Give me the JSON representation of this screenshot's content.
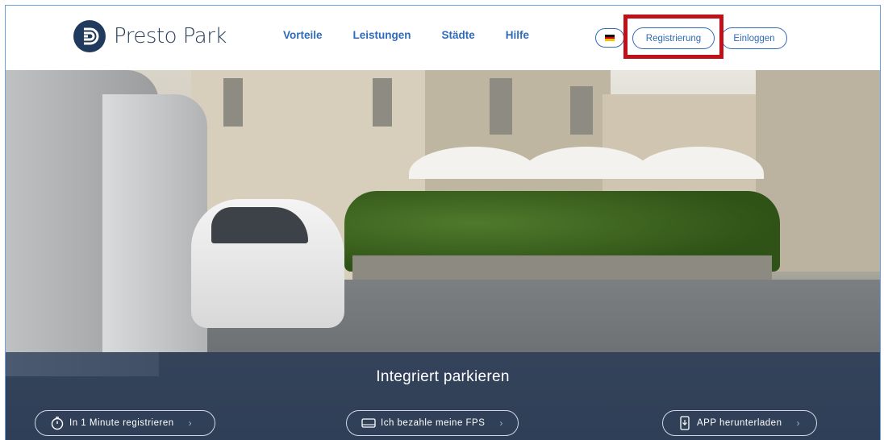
{
  "brand": {
    "name": "Presto Park"
  },
  "nav": {
    "items": [
      "Vorteile",
      "Leistungen",
      "Städte",
      "Hilfe"
    ]
  },
  "header": {
    "register_label": "Registrierung",
    "login_label": "Einloggen",
    "language_flag": "german-flag-icon"
  },
  "hero": {
    "title": "Integriert parkieren",
    "ctas": [
      {
        "label": "In 1 Minute registrieren",
        "icon": "stopwatch-icon"
      },
      {
        "label": "Ich bezahle meine FPS",
        "icon": "card-icon"
      },
      {
        "label": "APP herunterladen",
        "icon": "phone-download-icon"
      }
    ]
  },
  "colors": {
    "brand_blue": "#2f6bb8",
    "logo_navy": "#1f3a5c",
    "highlight_red": "#c0101a",
    "band_overlay": "#1e3250"
  }
}
